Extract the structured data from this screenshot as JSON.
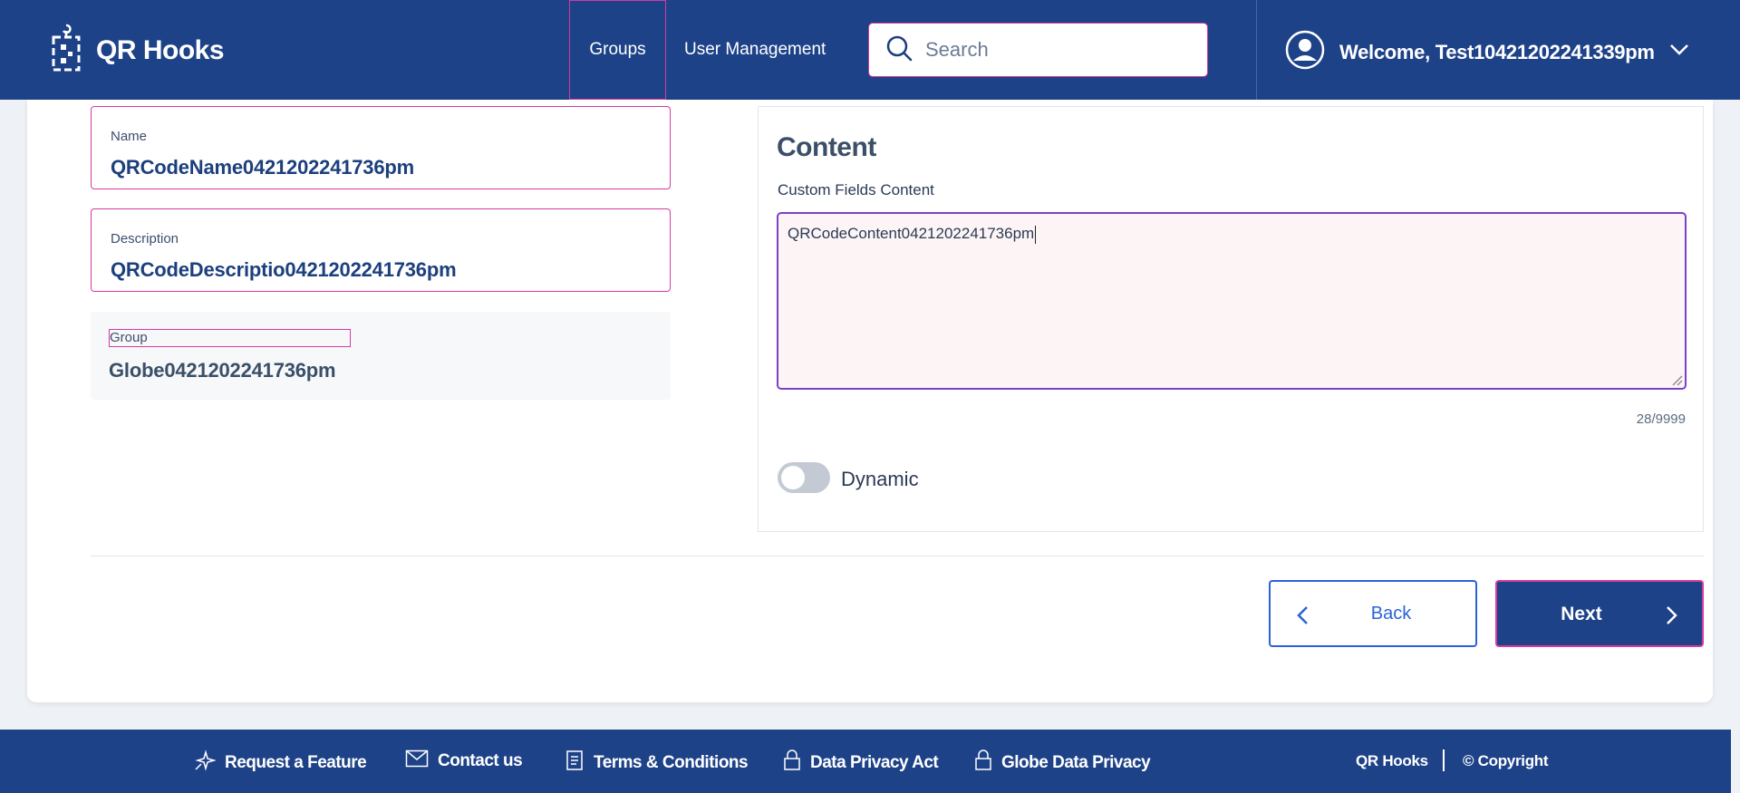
{
  "header": {
    "app_name": "QR Hooks",
    "nav": {
      "groups": "Groups",
      "user_management": "User Management"
    },
    "search": {
      "placeholder": "Search"
    },
    "welcome": "Welcome, Test10421202241339pm"
  },
  "form": {
    "name": {
      "label": "Name",
      "value": "QRCodeName0421202241736pm"
    },
    "description": {
      "label": "Description",
      "value": "QRCodeDescriptio0421202241736pm"
    },
    "group": {
      "label": "Group",
      "value": "Globe0421202241736pm"
    }
  },
  "content": {
    "title": "Content",
    "custom_fields_label": "Custom Fields Content",
    "textarea_value": "QRCodeContent0421202241736pm",
    "char_count": "28/9999",
    "dynamic_label": "Dynamic",
    "dynamic_on": false
  },
  "actions": {
    "back": "Back",
    "next": "Next"
  },
  "footer": {
    "request_feature": "Request a Feature",
    "contact_us": "Contact us",
    "terms": "Terms & Conditions",
    "data_privacy_act": "Data Privacy Act",
    "globe_data_privacy": "Globe Data Privacy",
    "brand": "QR Hooks",
    "copyright": "© Copyright"
  },
  "colors": {
    "primary": "#1e4288",
    "highlight_border": "#d63aa0",
    "link_blue": "#2b63d6",
    "textarea_focus": "#7b40c8"
  },
  "icons": [
    "qr-hook-logo-icon",
    "search-icon",
    "user-avatar-icon",
    "chevron-down-icon",
    "chevron-left-icon",
    "chevron-right-icon",
    "sparkle-icon",
    "mail-icon",
    "document-icon",
    "lock-icon"
  ]
}
